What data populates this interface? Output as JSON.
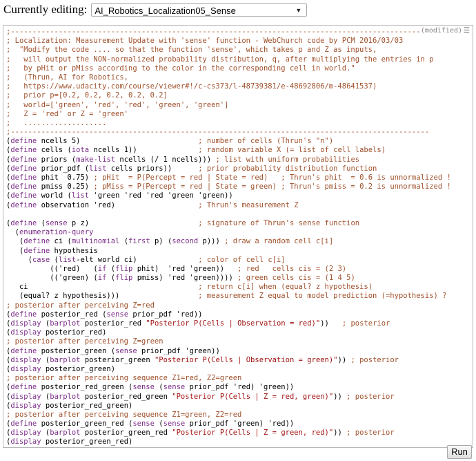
{
  "header": {
    "label": "Currently editing:",
    "selected_file": "AI_Robotics_Localization05_Sense"
  },
  "editor": {
    "modified_label": "(modified)",
    "menu_icon": "hamburger-icon",
    "lines": [
      {
        "type": "comment",
        "text": ";------------------------------------------------------------------------------------------------"
      },
      {
        "type": "comment",
        "text": "; Localization: Measurement Update with 'sense' function - WebChurch code by PCM 2016/03/03"
      },
      {
        "type": "comment",
        "text": ";  \"Modify the code .... so that the function 'sense', which takes p and Z as inputs,"
      },
      {
        "type": "comment",
        "text": ";   will output the NON-normalized probability distribution, q, after multiplying the entries in p"
      },
      {
        "type": "comment",
        "text": ";   by pHit or pMiss according to the color in the corresponding cell in world.\""
      },
      {
        "type": "comment",
        "text": ";   (Thrun, AI for Robotics,"
      },
      {
        "type": "comment",
        "text": ";   https://www.udacity.com/course/viewer#!/c-cs373/l-48739381/e-48692806/m-48641537)"
      },
      {
        "type": "comment",
        "text": ";   prior p=[0.2, 0.2, 0.2, 0.2, 0.2]"
      },
      {
        "type": "comment",
        "text": ";   world=['green', 'red', 'red', 'green', 'green']"
      },
      {
        "type": "comment",
        "text": ";   Z = 'red' or Z = 'green'"
      },
      {
        "type": "comment",
        "text": ";   ..................."
      },
      {
        "type": "comment",
        "text": ";------------------------------------------------------------------------------------------------"
      },
      {
        "type": "code",
        "text": "(define ncells 5)                           ; number of cells (Thrun's \"n\")"
      },
      {
        "type": "code",
        "text": "(define cells (iota ncells 1))              ; random variable X (= list of cell labels)"
      },
      {
        "type": "code",
        "text": "(define priors (make-list ncells (/ 1 ncells))) ; list with uniform probabilities"
      },
      {
        "type": "code",
        "text": "(define prior_pdf (list cells priors))      ; prior probability distribution function"
      },
      {
        "type": "code",
        "text": "(define phit  0.75) ; pHit  = P(Percept = red | State = red)   ; Thrun's phit  = 0.6 is unnormalized !"
      },
      {
        "type": "code",
        "text": "(define pmiss 0.25) ; pMiss = P(Percept = red | State = green) ; Thrun's pmiss = 0.2 is unnormalized !"
      },
      {
        "type": "code",
        "text": "(define world (list 'green 'red 'red 'green 'green))"
      },
      {
        "type": "code",
        "text": "(define observation 'red)                   ; Thrun's measurement Z"
      },
      {
        "type": "code",
        "text": ""
      },
      {
        "type": "code",
        "text": "(define (sense p z)                         ; signature of Thrun's sense function"
      },
      {
        "type": "code",
        "text": "  (enumeration-query"
      },
      {
        "type": "code",
        "text": "   (define ci (multinomial (first p) (second p))) ; draw a random cell c[i]"
      },
      {
        "type": "code",
        "text": "   (define hypothesis"
      },
      {
        "type": "code",
        "text": "     (case (list-elt world ci)              ; color of cell c[i]"
      },
      {
        "type": "code",
        "text": "          (('red)   (if (flip phit)  'red 'green))   ; red   cells cis = (2 3)"
      },
      {
        "type": "code",
        "text": "          (('green) (if (flip pmiss) 'red 'green)))) ; green cells cis = (1 4 5)"
      },
      {
        "type": "code",
        "text": "   ci                                       ; return c[i] when (equal? z hypothesis)"
      },
      {
        "type": "code",
        "text": "   (equal? z hypothesis)))                  ; measurement Z equal to model prediction (=hypothesis) ?"
      },
      {
        "type": "comment",
        "text": "; posterior after perceiving Z=red"
      },
      {
        "type": "code",
        "text": "(define posterior_red (sense prior_pdf 'red))"
      },
      {
        "type": "code",
        "text": "(display (barplot posterior_red \"Posterior P(Cells | Observation = red)\"))   ; posterior"
      },
      {
        "type": "code",
        "text": "(display posterior_red)"
      },
      {
        "type": "comment",
        "text": "; posterior after perceiving Z=green"
      },
      {
        "type": "code",
        "text": "(define posterior_green (sense prior_pdf 'green))"
      },
      {
        "type": "code",
        "text": "(display (barplot posterior_green \"Posterior P(Cells | Observation = green)\")) ; posterior"
      },
      {
        "type": "code",
        "text": "(display posterior_green)"
      },
      {
        "type": "comment",
        "text": "; posterior after perceiving sequence Z1=red, Z2=green"
      },
      {
        "type": "code",
        "text": "(define posterior_red_green (sense (sense prior_pdf 'red) 'green))"
      },
      {
        "type": "code",
        "text": "(display (barplot posterior_red_green \"Posterior P(Cells | Z = red, green)\")) ; posterior"
      },
      {
        "type": "code",
        "text": "(display posterior_red_green)"
      },
      {
        "type": "comment",
        "text": "; posterior after perceiving sequence Z1=green, Z2=red"
      },
      {
        "type": "code",
        "text": "(define posterior_green_red (sense (sense prior_pdf 'green) 'red))"
      },
      {
        "type": "code",
        "text": "(display (barplot posterior_green_red \"Posterior P(Cells | Z = green, red)\")) ; posterior"
      },
      {
        "type": "code",
        "text": "(display posterior_green_red)"
      },
      {
        "type": "comment",
        "text": ";------------------------------------------------------------------------------------------------"
      }
    ]
  },
  "run_button": {
    "label": "Run"
  },
  "colors": {
    "comment": "#a0522d",
    "keyword": "#7a2d87",
    "string": "#a31515"
  }
}
